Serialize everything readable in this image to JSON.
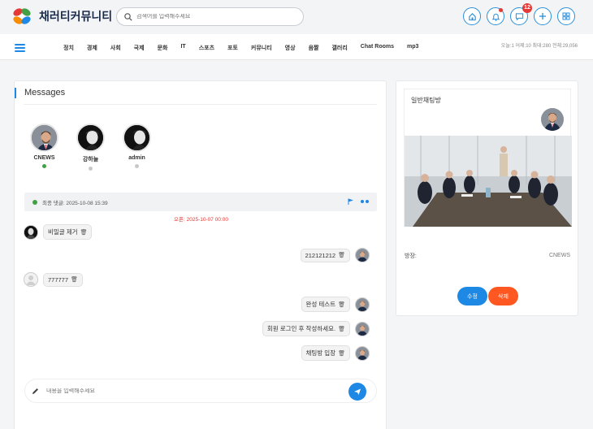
{
  "header": {
    "site_title": "채러티커뮤니티",
    "search_placeholder": "검색어를 입력해주세요",
    "message_badge": "12"
  },
  "nav": {
    "items": [
      "정치",
      "경제",
      "사회",
      "국제",
      "문화",
      "IT",
      "스포츠",
      "포토",
      "커뮤니티",
      "영상",
      "음짤",
      "갤러리",
      "Chat Rooms",
      "mp3"
    ],
    "visitors": "오늘:1 어제:10 최대:280 전체:29,056"
  },
  "messages": {
    "title": "Messages",
    "users": [
      {
        "name": "CNEWS",
        "status": "online"
      },
      {
        "name": "강하늘",
        "status": "offline"
      },
      {
        "name": "admin",
        "status": "offline"
      }
    ],
    "last_comment": "최종 댓글: 2025-10-08 15:39",
    "open_time": "오픈: 2025-10-07 00:00",
    "chat": [
      {
        "side": "left",
        "avatar": "tall-man",
        "text": "비밀글 제거"
      },
      {
        "side": "right",
        "avatar": "suit-man",
        "text": "212121212"
      },
      {
        "side": "left",
        "avatar": "blank",
        "text": "777777"
      },
      {
        "side": "right",
        "avatar": "suit-man",
        "text": "완성 테스트"
      },
      {
        "side": "right",
        "avatar": "suit-man",
        "text": "회원 로그인 후 작성하세요."
      },
      {
        "side": "right",
        "avatar": "suit-man",
        "text": "채팅방 입장"
      }
    ],
    "input_placeholder": "내용을 입력해주세요"
  },
  "room": {
    "title": "일반채팅방",
    "host_label": "방장:",
    "host_name": "CNEWS",
    "edit_label": "수정",
    "delete_label": "삭제"
  },
  "colors": {
    "accent": "#1e88e5",
    "danger": "#ff5722",
    "online": "#43a047",
    "badge": "#e53935"
  }
}
